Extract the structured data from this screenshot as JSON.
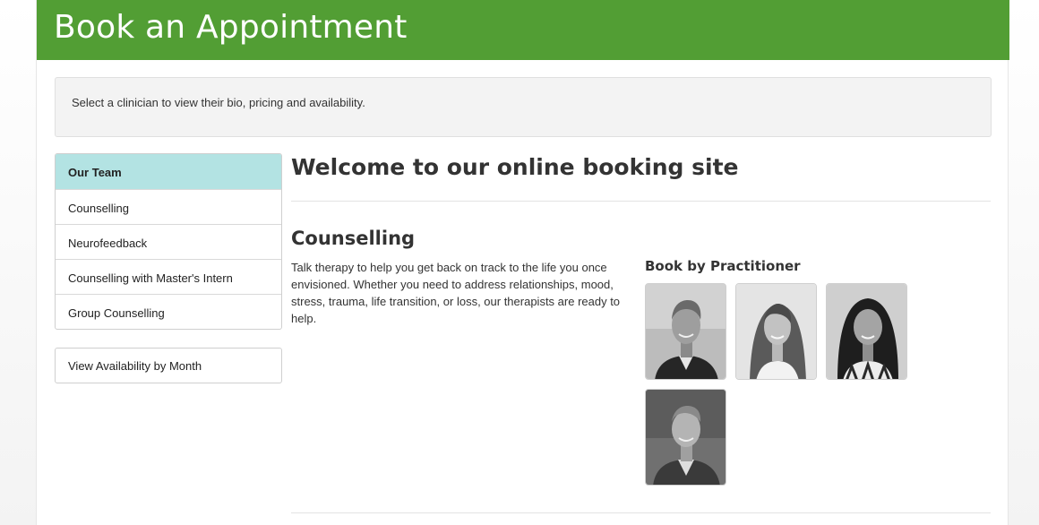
{
  "header": {
    "title": "Book an Appointment"
  },
  "notice": {
    "text": "Select a clinician to view their bio, pricing and availability."
  },
  "sidebar": {
    "items": [
      {
        "label": "Our Team",
        "active": true
      },
      {
        "label": "Counselling",
        "active": false
      },
      {
        "label": "Neurofeedback",
        "active": false
      },
      {
        "label": "Counselling with Master's Intern",
        "active": false
      },
      {
        "label": "Group Counselling",
        "active": false
      }
    ],
    "availability_label": "View Availability by Month"
  },
  "main": {
    "title": "Welcome to our online booking site",
    "section": {
      "title": "Counselling",
      "description": "Talk therapy to help you get back on track to the life you once envisioned. Whether you need to address relationships, mood, stress, trauma, life transition, or loss, our therapists are ready to help.",
      "practitioner_heading": "Book by Practitioner"
    }
  },
  "colors": {
    "header_bg": "#529e34",
    "active_nav_bg": "#b3e3e3"
  }
}
